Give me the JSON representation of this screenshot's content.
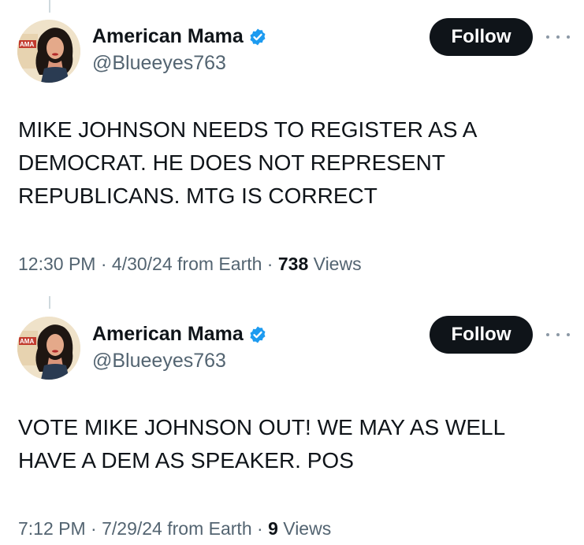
{
  "tweets": [
    {
      "display_name": "American Mama",
      "handle": "@Blueeyes763",
      "follow_label": "Follow",
      "text": "MIKE JOHNSON NEEDS TO REGISTER AS A\nDEMOCRAT. HE DOES NOT REPRESENT\nREPUBLICANS. MTG IS CORRECT",
      "time": "12:30 PM",
      "sep1": " · ",
      "date": "4/30/24",
      "source": " from Earth",
      "sep2": " · ",
      "views_count": "738",
      "views_label": " Views"
    },
    {
      "display_name": "American Mama",
      "handle": "@Blueeyes763",
      "follow_label": "Follow",
      "text": "VOTE MIKE JOHNSON OUT! WE MAY AS WELL\nHAVE A DEM AS SPEAKER. POS",
      "time": "7:12 PM",
      "sep1": " · ",
      "date": "7/29/24",
      "source": " from Earth",
      "sep2": " · ",
      "views_count": "9",
      "views_label": " Views"
    }
  ],
  "colors": {
    "verified_badge": "#1d9bf0",
    "follow_button_bg": "#0f1419",
    "secondary_text": "#536471",
    "avatar_poster": "#c23b2e"
  },
  "icons": {
    "verified": "verified-badge-icon",
    "more": "more-options-icon"
  },
  "avatar_logo_text": "AMA"
}
